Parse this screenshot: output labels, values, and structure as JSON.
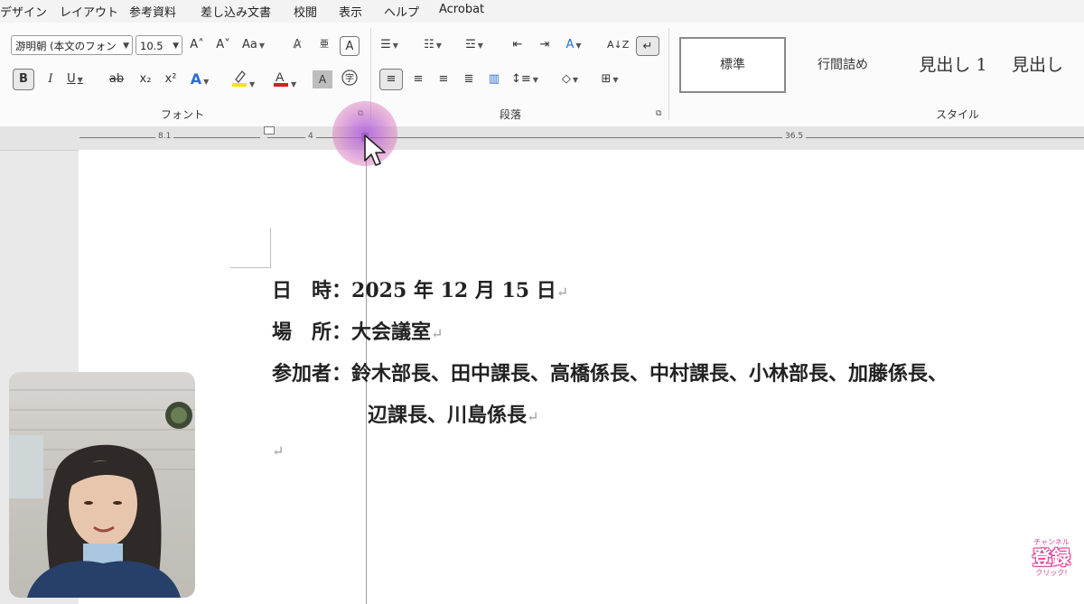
{
  "menu": {
    "tabs": [
      "デザイン",
      "レイアウト",
      "参考資料",
      "差し込み文書",
      "校閲",
      "表示",
      "ヘルプ",
      "Acrobat"
    ]
  },
  "ribbon": {
    "font_name": "游明朝 (本文のフォン",
    "font_size": "10.5",
    "groups": {
      "font": "フォント",
      "paragraph": "段落",
      "styles": "スタイル"
    },
    "font_buttons": {
      "grow": "A˄",
      "shrink": "A˅",
      "change_case": "Aa",
      "bold": "B",
      "italic": "I",
      "underline": "U",
      "strikethrough": "ab",
      "subscript": "x₂",
      "superscript": "x²"
    },
    "styles": [
      "標準",
      "行間詰め",
      "見出し 1",
      "見出し"
    ],
    "highlight_color": "#f4e600",
    "font_color": "#d32020"
  },
  "ruler": {
    "left_label": "8.1",
    "indent_label": "4",
    "right_label": "36.5"
  },
  "document": {
    "lines": [
      {
        "label": "日　時：",
        "value": "2025 年 12 月 15 日"
      },
      {
        "label": "場　所：",
        "value": "大会議室"
      },
      {
        "label": "参加者：",
        "value": "鈴木部長、田中課長、高橋係長、中村課長、小林部長、加藤係長、"
      },
      {
        "label": "",
        "value": "辺課長、川島係長"
      }
    ],
    "paragraph_mark": "↵"
  },
  "subscribe": {
    "top": "チャンネル",
    "main": "登録",
    "bottom": "クリック!"
  }
}
